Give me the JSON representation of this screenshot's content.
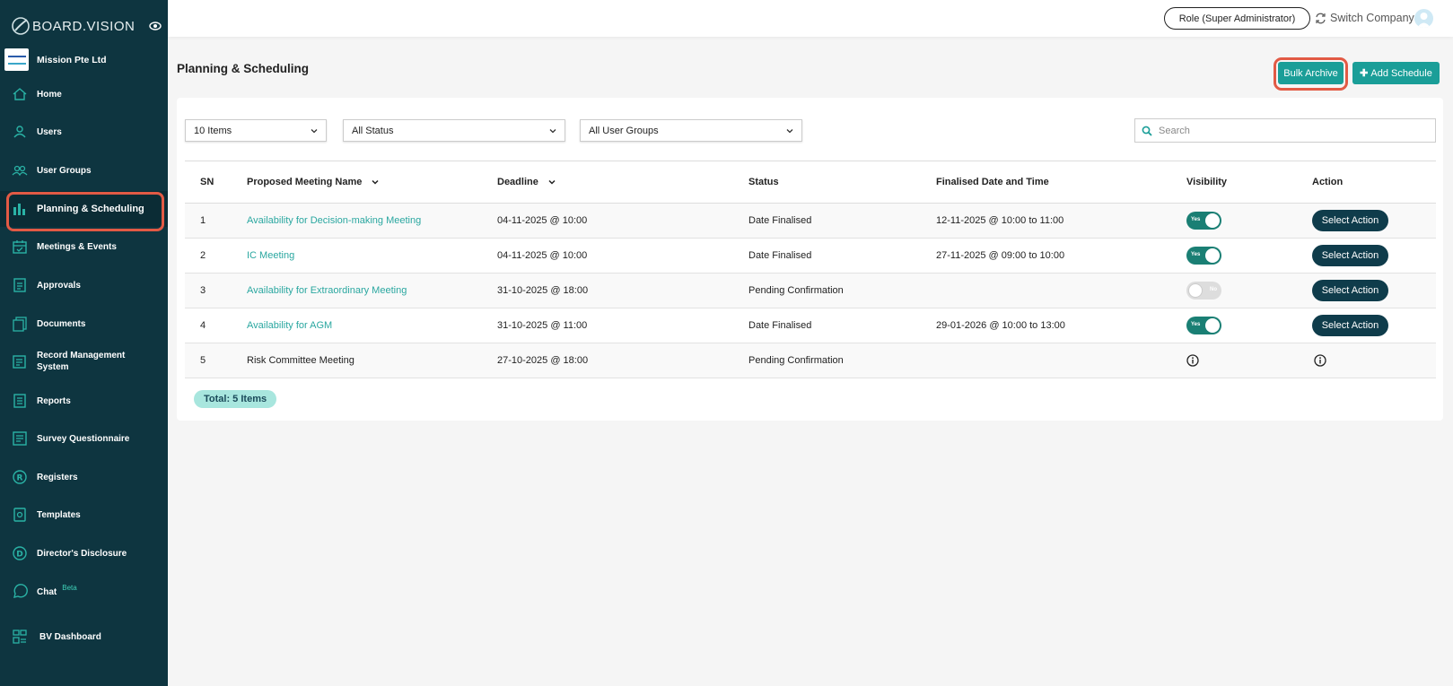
{
  "brand": {
    "name": "BOARD.VISION"
  },
  "company": {
    "name": "Mission Pte Ltd"
  },
  "sidebar": {
    "items": [
      {
        "label": "Home",
        "icon": "home-icon"
      },
      {
        "label": "Users",
        "icon": "user-icon"
      },
      {
        "label": "User Groups",
        "icon": "user-group-icon"
      },
      {
        "label": "Planning & Scheduling",
        "icon": "bar-chart-icon",
        "active": true
      },
      {
        "label": "Meetings & Events",
        "icon": "calendar-icon"
      },
      {
        "label": "Approvals",
        "icon": "document-check-icon"
      },
      {
        "label": "Documents",
        "icon": "documents-icon"
      },
      {
        "label": "Record Management System",
        "icon": "records-icon"
      },
      {
        "label": "Reports",
        "icon": "report-icon"
      },
      {
        "label": "Survey Questionnaire",
        "icon": "survey-icon"
      },
      {
        "label": "Registers",
        "icon": "registered-icon"
      },
      {
        "label": "Templates",
        "icon": "template-icon"
      },
      {
        "label": "Director's Disclosure",
        "icon": "disclosure-icon"
      },
      {
        "label": "Chat",
        "icon": "chat-icon",
        "badge": "Beta"
      },
      {
        "label": "BV Dashboard",
        "icon": "dashboard-icon"
      }
    ]
  },
  "topbar": {
    "role_label": "Role (Super Administrator)",
    "switch_label": "Switch Company"
  },
  "page": {
    "title": "Planning & Scheduling",
    "bulk_archive_label": "Bulk Archive",
    "add_schedule_label": "Add Schedule"
  },
  "filters": {
    "items_per_page": "10 Items",
    "status": "All Status",
    "user_groups": "All User Groups",
    "search_placeholder": "Search"
  },
  "table": {
    "columns": [
      "SN",
      "Proposed Meeting Name",
      "Deadline",
      "Status",
      "Finalised Date and Time",
      "Visibility",
      "Action"
    ],
    "rows": [
      {
        "sn": "1",
        "name": "Availability for Decision-making Meeting",
        "deadline": "04-11-2025 @ 10:00",
        "status": "Date Finalised",
        "finalised": "12-11-2025 @ 10:00 to 11:00",
        "visibility": "Yes",
        "action": "Select Action"
      },
      {
        "sn": "2",
        "name": "IC Meeting",
        "deadline": "04-11-2025 @ 10:00",
        "status": "Date Finalised",
        "finalised": "27-11-2025 @ 09:00 to 10:00",
        "visibility": "Yes",
        "action": "Select Action"
      },
      {
        "sn": "3",
        "name": "Availability for Extraordinary Meeting",
        "deadline": "31-10-2025 @ 18:00",
        "status": "Pending Confirmation",
        "finalised": "",
        "visibility": "No",
        "action": "Select Action"
      },
      {
        "sn": "4",
        "name": "Availability for AGM",
        "deadline": "31-10-2025 @ 11:00",
        "status": "Date Finalised",
        "finalised": "29-01-2026 @ 10:00 to 13:00",
        "visibility": "Yes",
        "action": "Select Action"
      },
      {
        "sn": "5",
        "name": "Risk Committee Meeting",
        "deadline": "27-10-2025 @ 18:00",
        "status": "Pending Confirmation",
        "finalised": "",
        "visibility": "",
        "action": ""
      }
    ]
  },
  "total_label": "Total: 5 Items",
  "colors": {
    "sidebar_bg": "#0e3540",
    "accent": "#1a9e98",
    "action_bg": "#0f3c4b",
    "highlight": "#e25a45"
  }
}
